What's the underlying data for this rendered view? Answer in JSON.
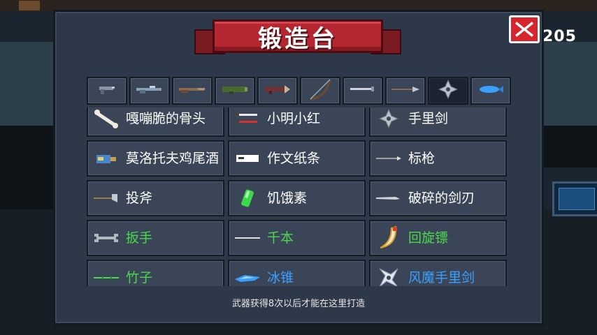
{
  "hud": {
    "coins": "205"
  },
  "forge": {
    "title": "锻造台",
    "hint": "武器获得8次以后才能在这里打造",
    "tabs": [
      {
        "icon": "pistol-icon"
      },
      {
        "icon": "rifle-icon"
      },
      {
        "icon": "shotgun-icon"
      },
      {
        "icon": "launcher-icon"
      },
      {
        "icon": "rocket-icon"
      },
      {
        "icon": "bow-icon"
      },
      {
        "icon": "sword-icon"
      },
      {
        "icon": "spear-icon"
      },
      {
        "icon": "shuriken-icon",
        "active": true
      },
      {
        "icon": "fish-icon"
      }
    ],
    "items": [
      {
        "label": "嘎嘣脆的骨头",
        "color": "white",
        "icon": "bone-icon"
      },
      {
        "label": "小明小红",
        "color": "white",
        "icon": "darts-icon"
      },
      {
        "label": "手里剑",
        "color": "white",
        "icon": "shuriken-icon"
      },
      {
        "label": "莫洛托夫鸡尾酒",
        "color": "white",
        "icon": "molotov-icon"
      },
      {
        "label": "作文纸条",
        "color": "white",
        "icon": "paper-note-icon"
      },
      {
        "label": "标枪",
        "color": "white",
        "icon": "javelin-icon"
      },
      {
        "label": "投斧",
        "color": "white",
        "icon": "throwing-axe-icon"
      },
      {
        "label": "饥饿素",
        "color": "white",
        "icon": "green-vial-icon"
      },
      {
        "label": "破碎的剑刃",
        "color": "white",
        "icon": "broken-blade-icon"
      },
      {
        "label": "扳手",
        "color": "green",
        "icon": "wrench-icon"
      },
      {
        "label": "千本",
        "color": "green",
        "icon": "needle-icon"
      },
      {
        "label": "回旋镖",
        "color": "green",
        "icon": "boomerang-icon"
      },
      {
        "label": "竹子",
        "color": "green",
        "icon": "bamboo-icon"
      },
      {
        "label": "冰锥",
        "color": "blue",
        "icon": "icicle-icon"
      },
      {
        "label": "风魔手里剑",
        "color": "blue",
        "icon": "fuma-shuriken-icon"
      }
    ]
  }
}
